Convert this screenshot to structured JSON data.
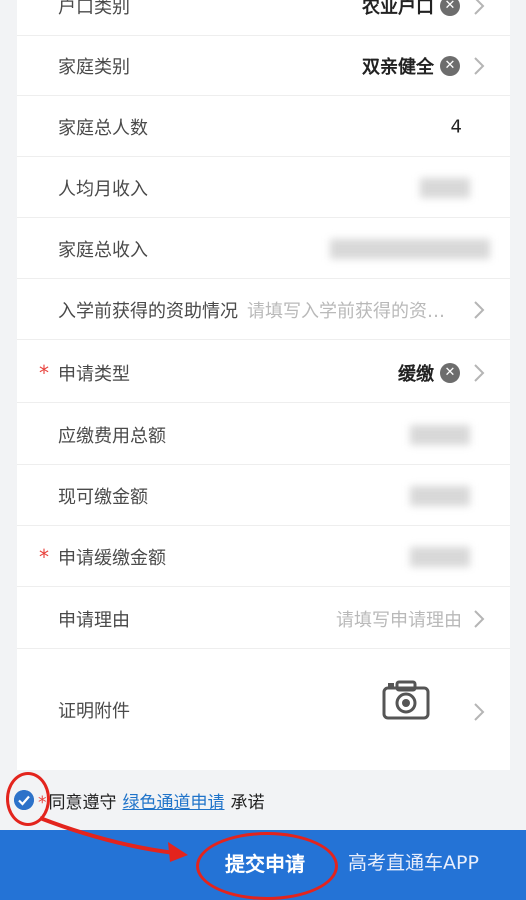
{
  "form": {
    "rows": [
      {
        "label": "户口类别",
        "value": "农业户口"
      },
      {
        "label": "家庭类别",
        "value": "双亲健全"
      },
      {
        "label": "家庭总人数",
        "value": "4"
      },
      {
        "label": "人均月收入",
        "value": ""
      },
      {
        "label": "家庭总收入",
        "value": ""
      },
      {
        "label": "入学前获得的资助情况",
        "placeholder": "请填写入学前获得的资助情况"
      },
      {
        "label": "申请类型",
        "value": "缓缴",
        "required": true
      },
      {
        "label": "应缴费用总额",
        "value": ""
      },
      {
        "label": "现可缴金额",
        "value": ""
      },
      {
        "label": "申请缓缴金额",
        "value": "",
        "required": true
      },
      {
        "label": "申请理由",
        "placeholder": "请填写申请理由"
      },
      {
        "label": "证明附件",
        "icon": "camera-icon"
      }
    ],
    "required_mark": "*",
    "clear_glyph": "✕"
  },
  "agreement": {
    "prefix": "同意遵守",
    "link": "绿色通道申请",
    "suffix": "承诺",
    "checked": true
  },
  "footer": {
    "submit_label": "提交申请",
    "watermark": "高考直通车APP"
  },
  "colors": {
    "primary": "#2473d6",
    "link": "#1f73c9",
    "required": "#e8413b",
    "annotation": "#e3241d"
  }
}
